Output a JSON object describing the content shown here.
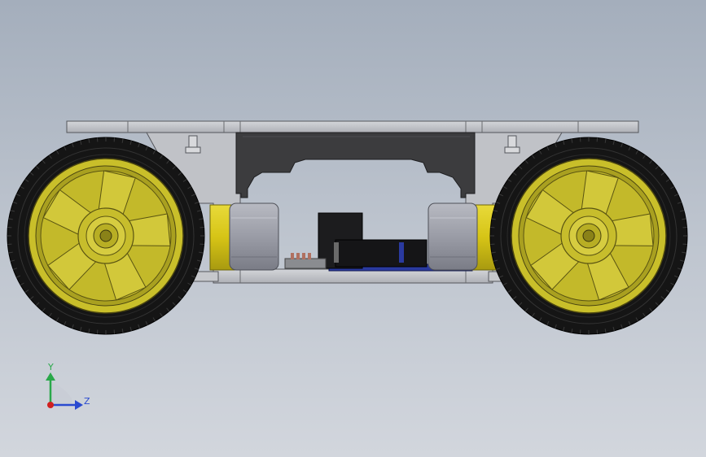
{
  "viewport": {
    "background_top": "#a4aebc",
    "background_bottom": "#d2d6dd"
  },
  "model": {
    "frame_color": "#c4c6ca",
    "tire_color": "#151515",
    "rim_color": "#c9bf2a",
    "motor_yellow": "#e2d21a",
    "motor_gray": "#9c9ea8",
    "bracket_color": "#3c3c3e",
    "pcb_color": "#2a3aa0"
  },
  "triad": {
    "y_label": "Y",
    "z_label": "Z",
    "y_color": "#2aa84a",
    "z_color": "#2a4ad0",
    "origin_color": "#d02020"
  }
}
